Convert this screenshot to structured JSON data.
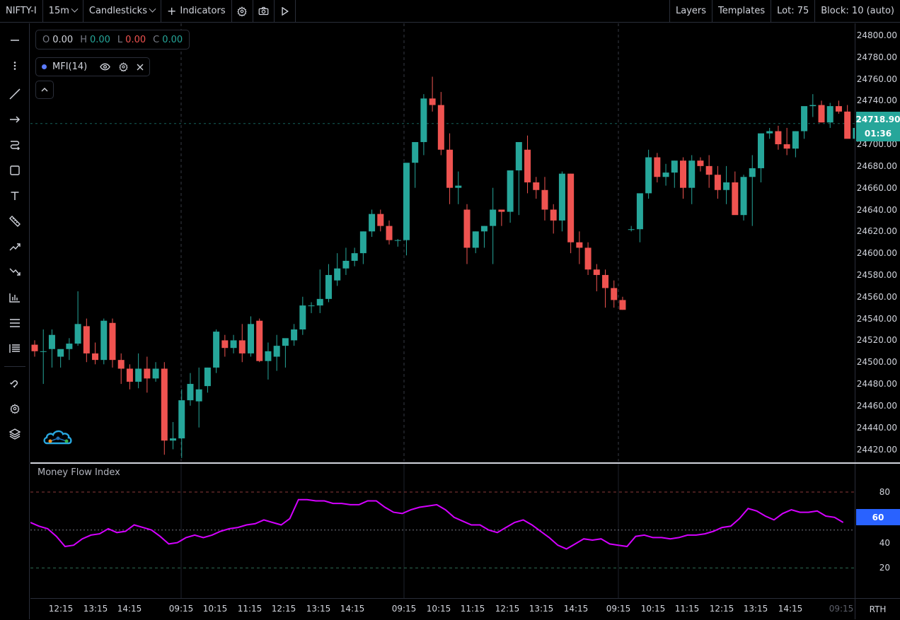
{
  "toolbar": {
    "symbol": "NIFTY-I",
    "interval": "15m",
    "chart_style": "Candlesticks",
    "indicators_label": "Indicators",
    "layers_label": "Layers",
    "templates_label": "Templates",
    "lot_label": "Lot: 75",
    "block_label": "Block: 10 (auto)"
  },
  "legend": {
    "o_key": "O",
    "o_val": "0.00",
    "h_key": "H",
    "h_val": "0.00",
    "l_key": "L",
    "l_val": "0.00",
    "c_key": "C",
    "c_val": "0.00",
    "indicator_name": "MFI(14)"
  },
  "price_tag": {
    "price": "24718.90",
    "countdown": "01:36"
  },
  "mfi_tag": "60",
  "sub_title": "Money Flow Index",
  "rth_label": "RTH",
  "colors": {
    "up": "#26a69a",
    "down": "#ef5350",
    "mfi_line": "#d400ff",
    "accent": "#2962ff"
  },
  "chart_data": {
    "type": "candlestick",
    "y_ticks": [
      "24800.00",
      "24780.00",
      "24760.00",
      "24740.00",
      "24720.00",
      "24700.00",
      "24680.00",
      "24660.00",
      "24640.00",
      "24620.00",
      "24600.00",
      "24580.00",
      "24560.00",
      "24540.00",
      "24520.00",
      "24500.00",
      "24480.00",
      "24460.00",
      "24440.00",
      "24420.00"
    ],
    "x_ticks": [
      "12:15",
      "13:15",
      "14:15",
      "09:15",
      "10:15",
      "11:15",
      "12:15",
      "13:15",
      "14:15",
      "09:15",
      "10:15",
      "11:15",
      "12:15",
      "13:15",
      "14:15",
      "09:15",
      "10:15",
      "11:15",
      "12:15",
      "13:15",
      "14:15",
      "09:15"
    ],
    "ylim": [
      24408,
      24811
    ],
    "candles": [
      [
        24516,
        24520,
        24505,
        24510
      ],
      [
        24510,
        24530,
        24480,
        24510
      ],
      [
        24512,
        24530,
        24495,
        24525
      ],
      [
        24505,
        24510,
        24495,
        24512
      ],
      [
        24512,
        24522,
        24502,
        24517
      ],
      [
        24517,
        24565,
        24515,
        24535
      ],
      [
        24533,
        24540,
        24500,
        24508
      ],
      [
        24508,
        24518,
        24498,
        24502
      ],
      [
        24502,
        24540,
        24498,
        24538
      ],
      [
        24536,
        24540,
        24495,
        24502
      ],
      [
        24502,
        24508,
        24480,
        24494
      ],
      [
        24494,
        24498,
        24475,
        24482
      ],
      [
        24482,
        24508,
        24476,
        24494
      ],
      [
        24494,
        24505,
        24472,
        24485
      ],
      [
        24485,
        24500,
        24482,
        24494
      ],
      [
        24494,
        24500,
        24415,
        24428
      ],
      [
        24428,
        24445,
        24420,
        24430
      ],
      [
        24430,
        24475,
        24412,
        24465
      ],
      [
        24465,
        24490,
        24460,
        24480
      ],
      [
        24464,
        24495,
        24440,
        24475
      ],
      [
        24478,
        24495,
        24472,
        24495
      ],
      [
        24495,
        24530,
        24490,
        24528
      ],
      [
        24520,
        24525,
        24505,
        24513
      ],
      [
        24513,
        24525,
        24508,
        24520
      ],
      [
        24520,
        24535,
        24500,
        24508
      ],
      [
        24508,
        24542,
        24505,
        24535
      ],
      [
        24538,
        24540,
        24500,
        24501
      ],
      [
        24501,
        24518,
        24484,
        24510
      ],
      [
        24505,
        24525,
        24492,
        24515
      ],
      [
        24515,
        24520,
        24495,
        24522
      ],
      [
        24520,
        24535,
        24515,
        24530
      ],
      [
        24530,
        24560,
        24525,
        24552
      ],
      [
        24552,
        24555,
        24545,
        24552
      ],
      [
        24552,
        24585,
        24545,
        24558
      ],
      [
        24558,
        24590,
        24555,
        24580
      ],
      [
        24575,
        24600,
        24570,
        24586
      ],
      [
        24586,
        24605,
        24580,
        24593
      ],
      [
        24593,
        24605,
        24588,
        24600
      ],
      [
        24600,
        24620,
        24590,
        24620
      ],
      [
        24620,
        24640,
        24615,
        24636
      ],
      [
        24636,
        24640,
        24620,
        24625
      ],
      [
        24625,
        24630,
        24608,
        24612
      ],
      [
        24612,
        24613,
        24606,
        24612
      ],
      [
        24612,
        24665,
        24598,
        24683
      ],
      [
        24683,
        24700,
        24660,
        24702
      ],
      [
        24702,
        24746,
        24690,
        24742
      ],
      [
        24742,
        24762,
        24730,
        24736
      ],
      [
        24736,
        24748,
        24690,
        24695
      ],
      [
        24695,
        24710,
        24645,
        24660
      ],
      [
        24660,
        24675,
        24645,
        24662
      ],
      [
        24640,
        24645,
        24590,
        24605
      ],
      [
        24605,
        24620,
        24600,
        24620
      ],
      [
        24620,
        24625,
        24605,
        24625
      ],
      [
        24625,
        24660,
        24590,
        24640
      ],
      [
        24640,
        24640,
        24625,
        24638
      ],
      [
        24638,
        24656,
        24628,
        24676
      ],
      [
        24676,
        24700,
        24635,
        24702
      ],
      [
        24695,
        24708,
        24655,
        24665
      ],
      [
        24665,
        24670,
        24650,
        24658
      ],
      [
        24658,
        24670,
        24630,
        24640
      ],
      [
        24640,
        24645,
        24618,
        24630
      ],
      [
        24630,
        24675,
        24620,
        24673
      ],
      [
        24673,
        24673,
        24600,
        24610
      ],
      [
        24610,
        24620,
        24590,
        24605
      ],
      [
        24605,
        24610,
        24580,
        24585
      ],
      [
        24585,
        24590,
        24565,
        24580
      ],
      [
        24580,
        24585,
        24550,
        24568
      ],
      [
        24568,
        24575,
        24550,
        24557
      ],
      [
        24557,
        24560,
        24548,
        24548
      ],
      [
        24622,
        24625,
        24620,
        24622
      ],
      [
        24622,
        24650,
        24610,
        24655
      ],
      [
        24655,
        24695,
        24650,
        24688
      ],
      [
        24688,
        24692,
        24665,
        24670
      ],
      [
        24670,
        24682,
        24662,
        24674
      ],
      [
        24674,
        24685,
        24660,
        24685
      ],
      [
        24685,
        24688,
        24650,
        24660
      ],
      [
        24660,
        24690,
        24645,
        24685
      ],
      [
        24685,
        24688,
        24675,
        24680
      ],
      [
        24680,
        24690,
        24660,
        24672
      ],
      [
        24672,
        24680,
        24650,
        24658
      ],
      [
        24658,
        24680,
        24645,
        24665
      ],
      [
        24665,
        24675,
        24640,
        24635
      ],
      [
        24635,
        24672,
        24630,
        24670
      ],
      [
        24670,
        24690,
        24625,
        24678
      ],
      [
        24678,
        24707,
        24665,
        24710
      ],
      [
        24710,
        24715,
        24705,
        24712
      ],
      [
        24712,
        24717,
        24695,
        24700
      ],
      [
        24700,
        24715,
        24690,
        24696
      ],
      [
        24696,
        24712,
        24688,
        24712
      ],
      [
        24712,
        24724,
        24705,
        24735
      ],
      [
        24735,
        24746,
        24725,
        24736
      ],
      [
        24736,
        24740,
        24725,
        24720
      ],
      [
        24720,
        24738,
        24715,
        24735
      ],
      [
        24735,
        24740,
        24728,
        24730
      ],
      [
        24730,
        24736,
        24710,
        24705
      ],
      [
        24705,
        24716,
        24700,
        24715
      ],
      [
        24718,
        24719,
        24718,
        24719
      ]
    ],
    "mfi": [
      56,
      53,
      51,
      45,
      37,
      38,
      43,
      46,
      47,
      51,
      48,
      49,
      54,
      52,
      50,
      45,
      39,
      40,
      44,
      46,
      44,
      46,
      49,
      51,
      52,
      54,
      55,
      58,
      56,
      54,
      59,
      74,
      74,
      73,
      73,
      71,
      71,
      70,
      70,
      73,
      73,
      68,
      64,
      63,
      66,
      68,
      69,
      70,
      66,
      60,
      57,
      54,
      54,
      50,
      48,
      52,
      56,
      58,
      54,
      49,
      44,
      38,
      35,
      39,
      43,
      42,
      43,
      39,
      38,
      37,
      45,
      46,
      44,
      44,
      43,
      44,
      46,
      46,
      47,
      49,
      52,
      53,
      59,
      67,
      65,
      61,
      58,
      63,
      66,
      64,
      64,
      65,
      61,
      60,
      56
    ]
  }
}
